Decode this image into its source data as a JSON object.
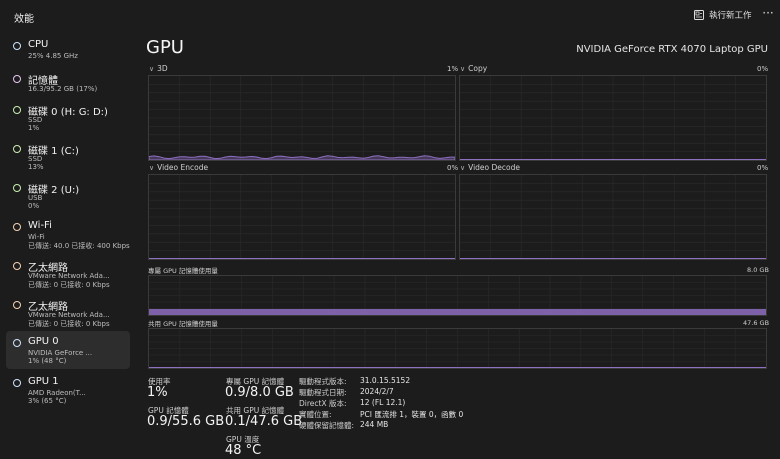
{
  "header": {
    "title": "效能",
    "run_task_label": "執行新工作",
    "more_label": "···"
  },
  "sidebar": {
    "items": [
      {
        "name": "CPU",
        "line1": "25%  4.85 GHz",
        "line2": "",
        "color": "#cfe6ff"
      },
      {
        "name": "記憶體",
        "line1": "16.3/95.2 GB (17%)",
        "line2": "",
        "color": "#e6c8f0"
      },
      {
        "name": "磁碟 0 (H: G: D:)",
        "line1": "SSD",
        "line2": "1%",
        "color": "#c9efb0"
      },
      {
        "name": "磁碟 1 (C:)",
        "line1": "SSD",
        "line2": "13%",
        "color": "#c9efb0"
      },
      {
        "name": "磁碟 2 (U:)",
        "line1": "USB",
        "line2": "0%",
        "color": "#c9efb0"
      },
      {
        "name": "Wi-Fi",
        "line1": "Wi-Fi",
        "line2": "已傳送: 40.0  已接收: 400 Kbps",
        "color": "#f7d2b2"
      },
      {
        "name": "乙太網路",
        "line1": "VMware Network Ada...",
        "line2": "已傳送: 0  已接收: 0 Kbps",
        "color": "#f7d2b2"
      },
      {
        "name": "乙太網路",
        "line1": "VMware Network Ada...",
        "line2": "已傳送: 0  已接收: 0 Kbps",
        "color": "#f7d2b2"
      },
      {
        "name": "GPU 0",
        "line1": "NVIDIA GeForce ...",
        "line2": "1% (48 °C)",
        "color": "#cfe6ff"
      },
      {
        "name": "GPU 1",
        "line1": "AMD Radeon(T...",
        "line2": "3% (65 °C)",
        "color": "#cfe6ff"
      }
    ],
    "active_index": 8
  },
  "main": {
    "title": "GPU",
    "model": "NVIDIA GeForce RTX 4070 Laptop GPU",
    "graphs": {
      "g3d": {
        "label": "3D",
        "pct": "1%"
      },
      "copy": {
        "label": "Copy",
        "pct": "0%"
      },
      "encode": {
        "label": "Video Encode",
        "pct": "0%"
      },
      "decode": {
        "label": "Video Decode",
        "pct": "0%"
      }
    },
    "dedicated_mem": {
      "label": "專屬 GPU 記憶體使用量",
      "max": "8.0 GB"
    },
    "shared_mem": {
      "label": "共用 GPU 記憶體使用量",
      "max": "47.6 GB"
    }
  },
  "stats": {
    "usage_label": "使用率",
    "usage_value": "1%",
    "gpu_mem_label": "GPU 記憶體",
    "gpu_mem_value": "0.9/55.6 GB",
    "dedicated_label": "專屬 GPU 記憶體",
    "dedicated_value": "0.9/8.0 GB",
    "shared_label": "共用 GPU 記憶體",
    "shared_value": "0.1/47.6 GB",
    "temp_label": "GPU 溫度",
    "temp_value": "48 °C"
  },
  "info": [
    {
      "key": "驅動程式版本:",
      "val": "31.0.15.5152"
    },
    {
      "key": "驅動程式日期:",
      "val": "2024/2/7"
    },
    {
      "key": "DirectX 版本:",
      "val": "12 (FL 12.1)"
    },
    {
      "key": "實體位置:",
      "val": "PCI 匯流排 1，裝置 0，函數 0"
    },
    {
      "key": "硬體保留記憶體:",
      "val": "244 MB"
    }
  ],
  "colors": {
    "accent": "#8f6fc2",
    "grid": "#2b2b2b",
    "border": "#3a3a3a"
  }
}
